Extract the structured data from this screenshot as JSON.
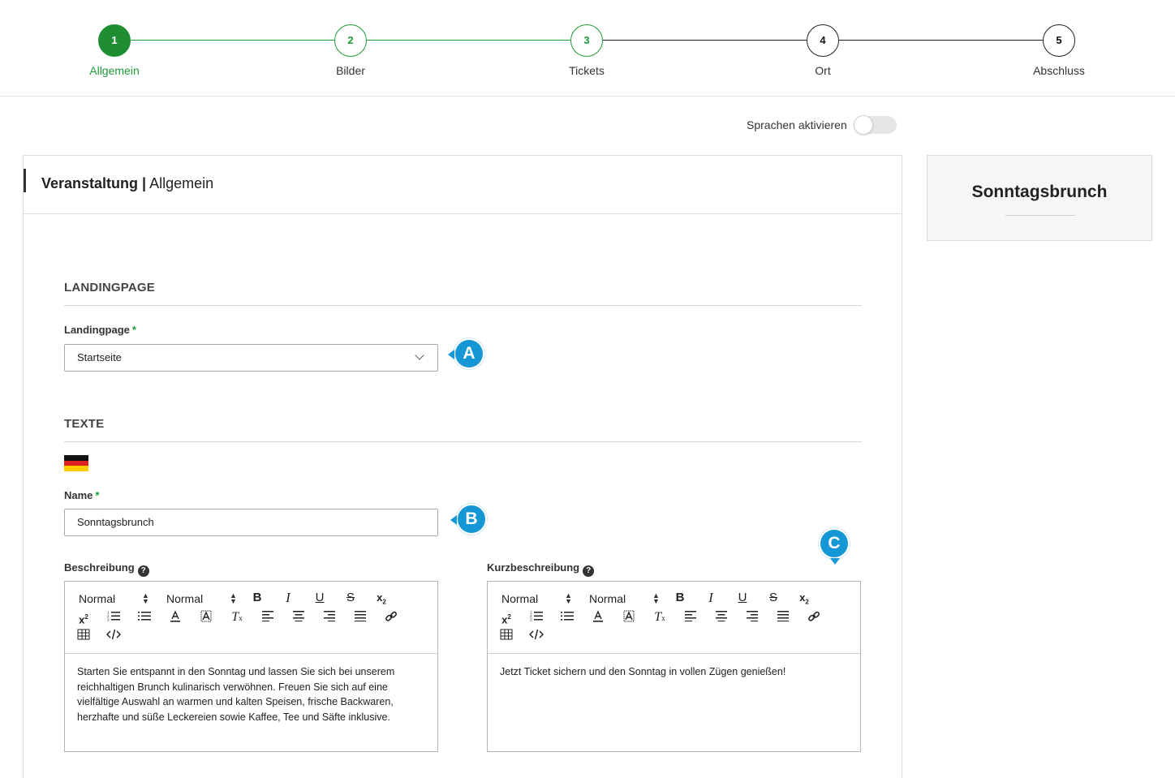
{
  "stepper": {
    "steps": [
      {
        "number": "1",
        "label": "Allgemein",
        "state": "active"
      },
      {
        "number": "2",
        "label": "Bilder",
        "state": "done"
      },
      {
        "number": "3",
        "label": "Tickets",
        "state": "done"
      },
      {
        "number": "4",
        "label": "Ort",
        "state": "todo"
      },
      {
        "number": "5",
        "label": "Abschluss",
        "state": "todo"
      }
    ],
    "colors": {
      "active": "#1f8e33",
      "done": "#1e9a36",
      "todo": "#222222"
    }
  },
  "language_toggle": {
    "label": "Sprachen aktivieren",
    "enabled": false
  },
  "card": {
    "title_bold": "Veranstaltung |",
    "title_rest": "Allgemein"
  },
  "landingpage_section": {
    "title": "LANDINGPAGE",
    "field_label": "Landingpage",
    "required_mark": "*",
    "selected_value": "Startseite"
  },
  "texte_section": {
    "title": "TEXTE",
    "language_flag": "de-flag-icon",
    "name_label": "Name",
    "name_required_mark": "*",
    "name_value": "Sonntagsbrunch",
    "description_label": "Beschreibung",
    "short_description_label": "Kurzbeschreibung",
    "help_glyph": "?",
    "editor_toolbar": {
      "select_1": "Normal",
      "select_2": "Normal",
      "bold": "B",
      "italic": "I",
      "underline": "U",
      "strike": "S"
    },
    "description_text": "Starten Sie entspannt in den Sonntag und lassen Sie sich bei unserem reichhaltigen Brunch kulinarisch verwöhnen. Freuen Sie sich auf eine vielfältige Auswahl an warmen und kalten Speisen, frische Backwaren, herzhafte und süße Leckereien sowie Kaffee, Tee und Säfte inklusive.",
    "short_description_text": "Jetzt Ticket sichern und den Sonntag in vollen Zügen genießen!"
  },
  "callouts": {
    "a": "A",
    "b": "B",
    "c": "C",
    "color": "#1597d6"
  },
  "side_card": {
    "title": "Sonntagsbrunch"
  }
}
